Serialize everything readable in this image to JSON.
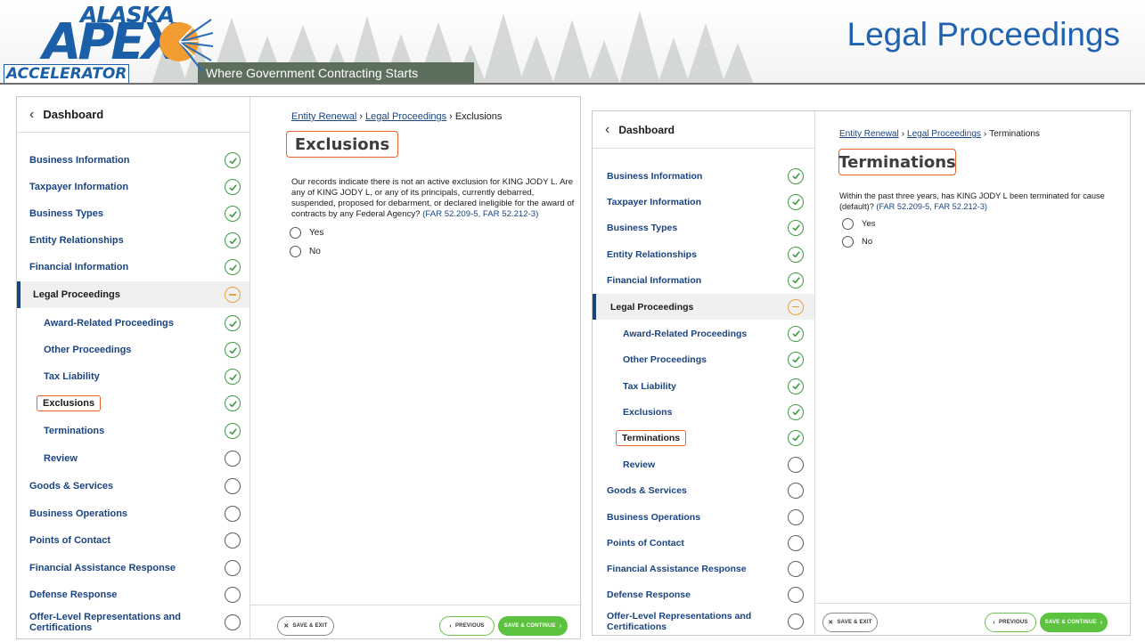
{
  "header": {
    "logo_top": "ALASKA",
    "logo_main": "APEX",
    "logo_bottom": "ACCELERATOR",
    "tagline": "Where Government Contracting Starts",
    "page_title": "Legal Proceedings",
    "brand_color": "#1a5fa8"
  },
  "left_panel": {
    "dashboard_label": "Dashboard",
    "nav_items": [
      {
        "label": "Business Information",
        "status": "done"
      },
      {
        "label": "Taxpayer Information",
        "status": "done"
      },
      {
        "label": "Business Types",
        "status": "done"
      },
      {
        "label": "Entity Relationships",
        "status": "done"
      },
      {
        "label": "Financial Information",
        "status": "done"
      },
      {
        "label": "Legal Proceedings",
        "status": "partial"
      },
      {
        "label": "Award-Related Proceedings",
        "status": "done"
      },
      {
        "label": "Other Proceedings",
        "status": "done"
      },
      {
        "label": "Tax Liability",
        "status": "done"
      },
      {
        "label": "Exclusions",
        "status": "done"
      },
      {
        "label": "Terminations",
        "status": "done"
      },
      {
        "label": "Review",
        "status": "empty"
      },
      {
        "label": "Goods & Services",
        "status": "empty"
      },
      {
        "label": "Business Operations",
        "status": "empty"
      },
      {
        "label": "Points of Contact",
        "status": "empty"
      },
      {
        "label": "Financial Assistance Response",
        "status": "empty"
      },
      {
        "label": "Defense Response",
        "status": "empty"
      },
      {
        "label": "Offer-Level Representations and Certifications",
        "status": "empty"
      }
    ],
    "breadcrumb": {
      "first": "Entity Renewal",
      "second": "Legal Proceedings",
      "current": "Exclusions"
    },
    "title": "Exclusions",
    "question": "Our records indicate there is not an active exclusion for KING JODY L. Are any of KING JODY L, or any of its principals, currently debarred, suspended, proposed for debarment, or declared ineligible for the award of contracts by any Federal Agency?",
    "question_refs": "(FAR 52.209-5, FAR 52.212-3)",
    "options": [
      "Yes",
      "No"
    ],
    "save_exit": "SAVE & EXIT",
    "previous": "PREVIOUS",
    "save_continue": "SAVE & CONTINUE"
  },
  "right_panel": {
    "dashboard_label": "Dashboard",
    "nav_items": [
      {
        "label": "Business Information",
        "status": "done"
      },
      {
        "label": "Taxpayer Information",
        "status": "done"
      },
      {
        "label": "Business Types",
        "status": "done"
      },
      {
        "label": "Entity Relationships",
        "status": "done"
      },
      {
        "label": "Financial Information",
        "status": "done"
      },
      {
        "label": "Legal Proceedings",
        "status": "partial"
      },
      {
        "label": "Award-Related Proceedings",
        "status": "done"
      },
      {
        "label": "Other Proceedings",
        "status": "done"
      },
      {
        "label": "Tax Liability",
        "status": "done"
      },
      {
        "label": "Exclusions",
        "status": "done"
      },
      {
        "label": "Terminations",
        "status": "done"
      },
      {
        "label": "Review",
        "status": "empty"
      },
      {
        "label": "Goods & Services",
        "status": "empty"
      },
      {
        "label": "Business Operations",
        "status": "empty"
      },
      {
        "label": "Points of Contact",
        "status": "empty"
      },
      {
        "label": "Financial Assistance Response",
        "status": "empty"
      },
      {
        "label": "Defense Response",
        "status": "empty"
      },
      {
        "label": "Offer-Level Representations and Certifications",
        "status": "empty"
      }
    ],
    "breadcrumb": {
      "first": "Entity Renewal",
      "second": "Legal Proceedings",
      "current": "Terminations"
    },
    "title": "Terminations",
    "question": "Within the past three years, has KING JODY L been terminated for cause (default)?",
    "question_refs": "(FAR 52.209-5, FAR 52.212-3)",
    "options": [
      "Yes",
      "No"
    ],
    "save_exit": "SAVE & EXIT",
    "previous": "PREVIOUS",
    "save_continue": "SAVE & CONTINUE"
  }
}
